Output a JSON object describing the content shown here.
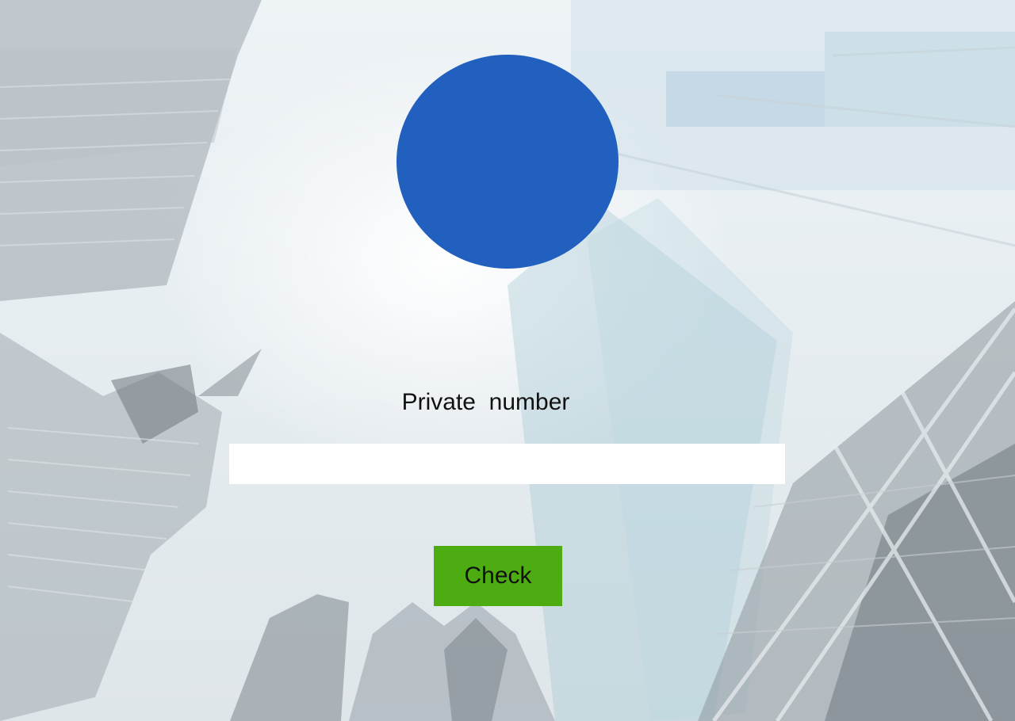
{
  "form": {
    "label": "Private  number",
    "input_value": "",
    "check_label": "Check"
  },
  "colors": {
    "logo": "#2260bf",
    "button": "#4cac11",
    "input_background": "#ffffff"
  }
}
